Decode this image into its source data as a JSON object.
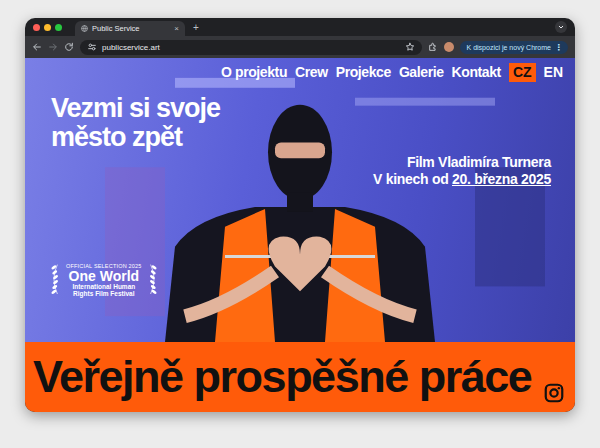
{
  "window": {
    "tabs": [
      {
        "label": "Public Service",
        "selected": true
      }
    ],
    "tab_close": "×",
    "new_tab": "+"
  },
  "toolbar": {
    "url": "publicservice.art",
    "update_button": "K dispozici je nový Chrome",
    "menu": "⋮"
  },
  "site": {
    "menu": [
      {
        "label": "O projektu"
      },
      {
        "label": "Crew"
      },
      {
        "label": "Projekce"
      },
      {
        "label": "Galerie"
      },
      {
        "label": "Kontakt"
      }
    ],
    "languages": [
      {
        "label": "CZ",
        "selected": true
      },
      {
        "label": "EN",
        "selected": false
      }
    ],
    "headline": [
      "Vezmi si svoje",
      "město zpět"
    ],
    "credit": "Film Vladimíra Turnera",
    "release_prefix": "V kinech od ",
    "release_date": "20. března 2025",
    "laurel": {
      "top": "OFFICIAL SELECTION 2025",
      "name": "One World",
      "subtitle": [
        "International Human",
        "Rights Film Festival"
      ]
    },
    "banner": "Veřejně prospěšné práce"
  }
}
